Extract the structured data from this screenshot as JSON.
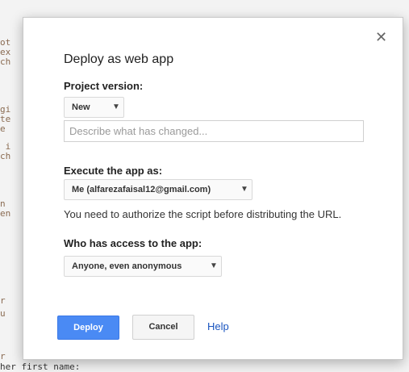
{
  "background_code": {
    "lines": [
      "ot",
      "ex",
      "ch",
      "gi",
      "te",
      "e",
      " i",
      "ch",
      "n",
      "en",
      "r",
      "u",
      "r",
      "her first name:"
    ]
  },
  "dialog": {
    "title": "Deploy as web app",
    "close_glyph": "✕",
    "project_version": {
      "label": "Project version:",
      "selected": "New",
      "description_placeholder": "Describe what has changed..."
    },
    "execute_as": {
      "label": "Execute the app as:",
      "selected": "Me (alfarezafaisal12@gmail.com)",
      "note": "You need to authorize the script before distributing the URL."
    },
    "access": {
      "label": "Who has access to the app:",
      "selected": "Anyone, even anonymous"
    },
    "buttons": {
      "deploy": "Deploy",
      "cancel": "Cancel",
      "help": "Help"
    },
    "caret_glyph": "▼"
  },
  "colors": {
    "primary": "#4a8af4",
    "link": "#1a55c0"
  }
}
